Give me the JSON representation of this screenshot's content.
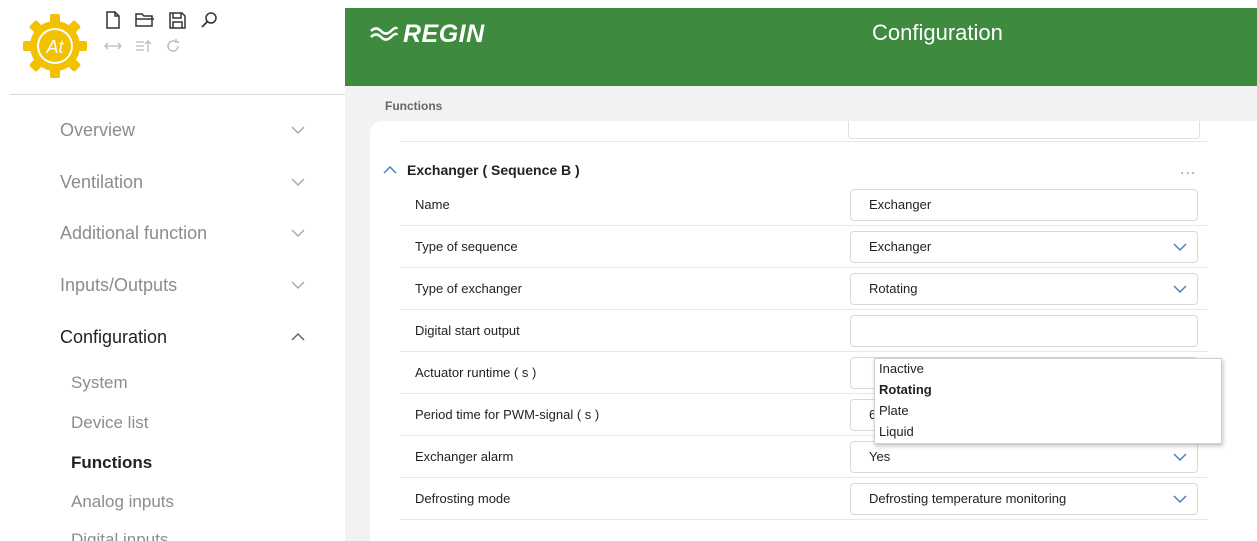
{
  "toolbar": {
    "row1": [
      "new-file-icon",
      "open-folder-icon",
      "save-icon",
      "search-icon"
    ],
    "row2": [
      "transfer-icon",
      "export-icon",
      "refresh-icon"
    ],
    "logo_text": "At"
  },
  "sidebar": {
    "items": [
      {
        "label": "Overview",
        "expanded": false
      },
      {
        "label": "Ventilation",
        "expanded": false
      },
      {
        "label": "Additional function",
        "expanded": false
      },
      {
        "label": "Inputs/Outputs",
        "expanded": false
      },
      {
        "label": "Configuration",
        "expanded": true
      }
    ],
    "subitems": [
      {
        "label": "System"
      },
      {
        "label": "Device list"
      },
      {
        "label": "Functions",
        "active": true
      },
      {
        "label": "Analog inputs"
      },
      {
        "label": "Digital inputs"
      }
    ]
  },
  "header": {
    "brand": "REGIN",
    "title": "Configuration",
    "color": "#3e8a3e"
  },
  "main": {
    "breadcrumb": "Functions",
    "section_title": "Exchanger ( Sequence B )",
    "more": "...",
    "rows": [
      {
        "label": "Name",
        "value": "Exchanger",
        "type": "text"
      },
      {
        "label": "Type of sequence",
        "value": "Exchanger",
        "type": "select"
      },
      {
        "label": "Type of exchanger",
        "value": "Rotating",
        "type": "select"
      },
      {
        "label": "Digital start output",
        "value": "",
        "type": "select"
      },
      {
        "label": "Actuator runtime ( s )",
        "value": "",
        "type": "text"
      },
      {
        "label": "Period time for PWM-signal ( s )",
        "value": "60",
        "type": "text"
      },
      {
        "label": "Exchanger alarm",
        "value": "Yes",
        "type": "select"
      },
      {
        "label": "Defrosting mode",
        "value": "Defrosting temperature monitoring",
        "type": "select"
      }
    ],
    "dropdown": {
      "options": [
        "Inactive",
        "Rotating",
        "Plate",
        "Liquid"
      ],
      "selected": "Rotating"
    }
  },
  "colors": {
    "accent": "#3e8a3e",
    "chevron": "#4a7fc1"
  }
}
